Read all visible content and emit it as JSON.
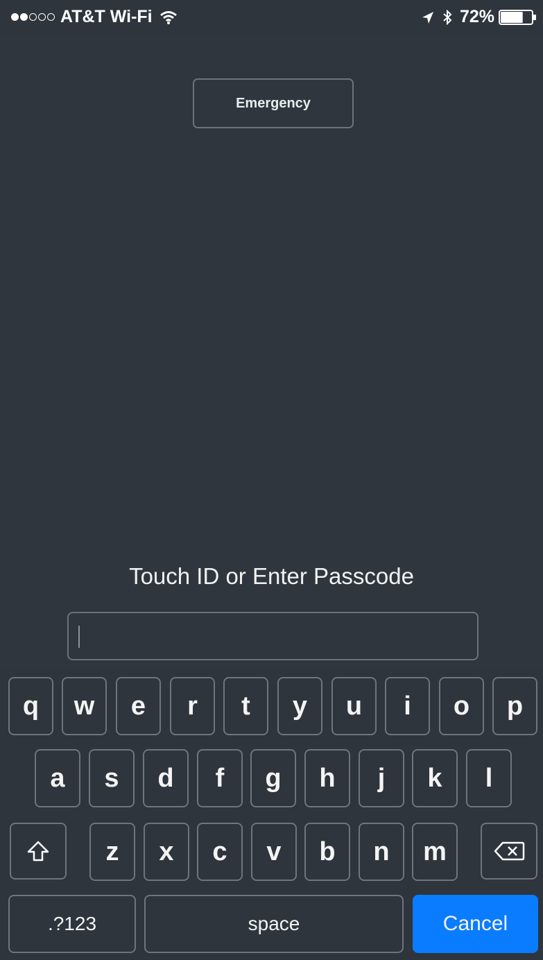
{
  "status_bar": {
    "signal_filled": 2,
    "signal_total": 5,
    "carrier": "AT&T Wi-Fi",
    "battery_percent_label": "72%",
    "battery_level": 0.72
  },
  "emergency": {
    "label": "Emergency"
  },
  "prompt": {
    "text": "Touch ID or Enter Passcode"
  },
  "passcode": {
    "value": ""
  },
  "keyboard": {
    "row1": [
      "q",
      "w",
      "e",
      "r",
      "t",
      "y",
      "u",
      "i",
      "o",
      "p"
    ],
    "row2": [
      "a",
      "s",
      "d",
      "f",
      "g",
      "h",
      "j",
      "k",
      "l"
    ],
    "row3": [
      "z",
      "x",
      "c",
      "v",
      "b",
      "n",
      "m"
    ],
    "mode_label": ".?123",
    "space_label": "space",
    "cancel_label": "Cancel"
  },
  "colors": {
    "background": "#2f363d",
    "key_border": "#6d767e",
    "cancel_blue": "#0a7cff"
  }
}
